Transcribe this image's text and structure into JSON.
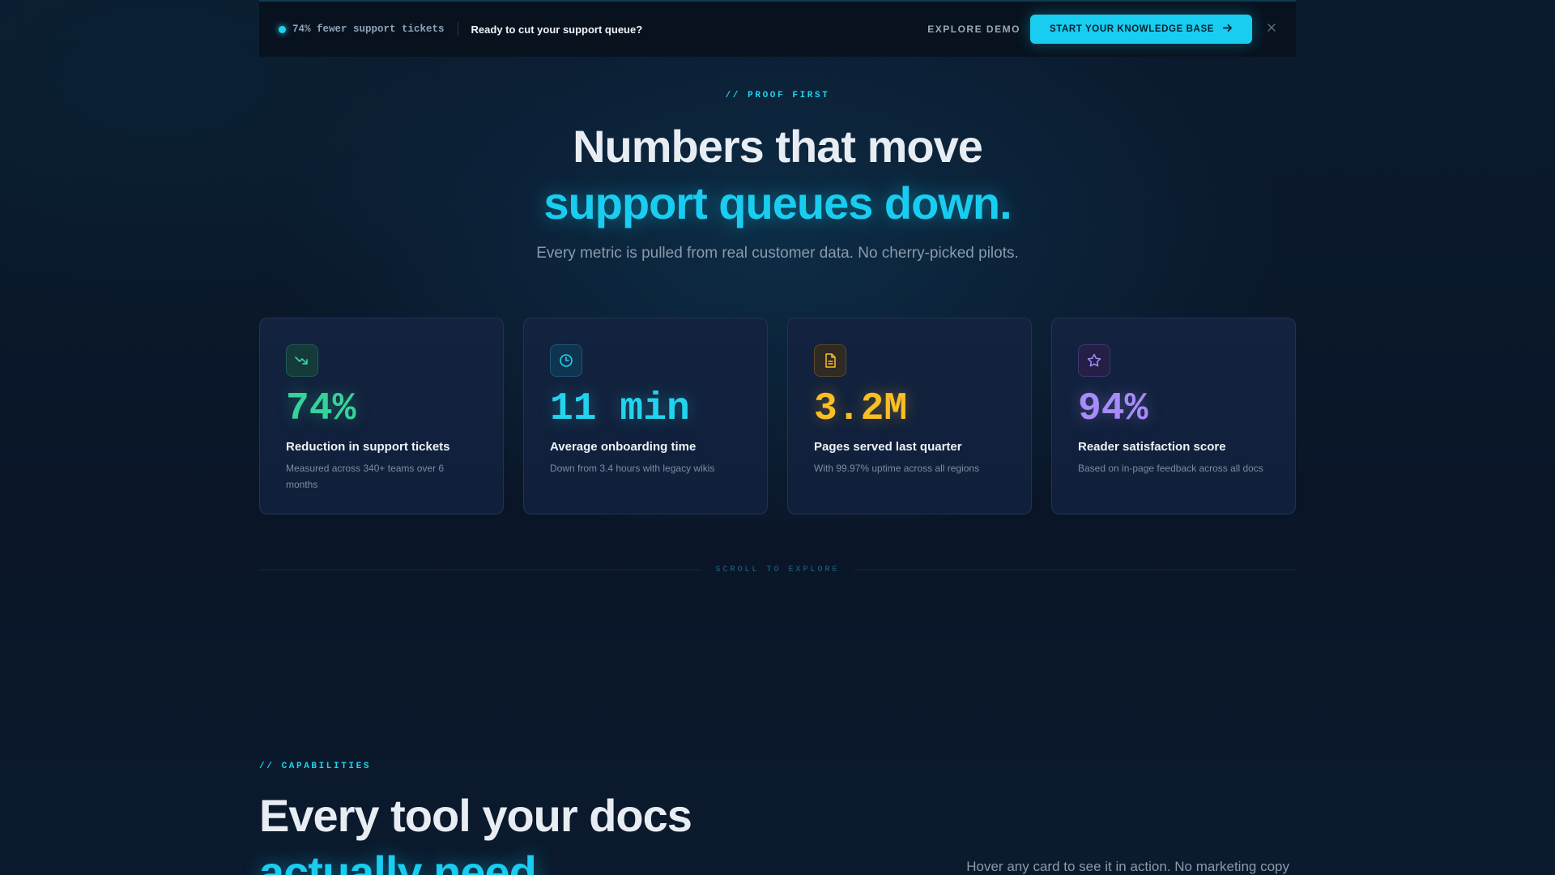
{
  "banner": {
    "badge_text": "74% fewer support tickets",
    "cta_text": "Ready to cut your support queue?",
    "explore_label": "EXPLORE DEMO",
    "primary_label": "START YOUR KNOWLEDGE BASE",
    "primary_icon": "arrow-right-icon",
    "close_icon": "close-icon"
  },
  "hero": {
    "eyebrow": "// PROOF FIRST",
    "title_line1": "Numbers that move",
    "title_line2": "support queues down.",
    "subtitle": "Every metric is pulled from real customer data. No cherry-picked pilots."
  },
  "stats": [
    {
      "icon": "trending-down-icon",
      "value": "74%",
      "label": "Reduction in support tickets",
      "desc": "Measured across 340+ teams over 6 months",
      "color": "#34d399"
    },
    {
      "icon": "clock-icon",
      "value": "11 min",
      "label": "Average onboarding time",
      "desc": "Down from 3.4 hours with legacy wikis",
      "color": "#22d3ee"
    },
    {
      "icon": "document-icon",
      "value": "3.2M",
      "label": "Pages served last quarter",
      "desc": "With 99.97% uptime across all regions",
      "color": "#fbbf24"
    },
    {
      "icon": "star-icon",
      "value": "94%",
      "label": "Reader satisfaction score",
      "desc": "Based on in-page feedback across all docs",
      "color": "#a78bfa"
    }
  ],
  "scroll_label": "SCROLL TO EXPLORE",
  "capabilities": {
    "eyebrow": "// CAPABILITIES",
    "title_line1": "Every tool your docs",
    "title_line2": "actually need.",
    "subtitle": "Hover any card to see it in action. No marketing copy"
  },
  "colors": {
    "accent": "#19cdf0",
    "background": "#0a1628",
    "card": "#12223e"
  }
}
